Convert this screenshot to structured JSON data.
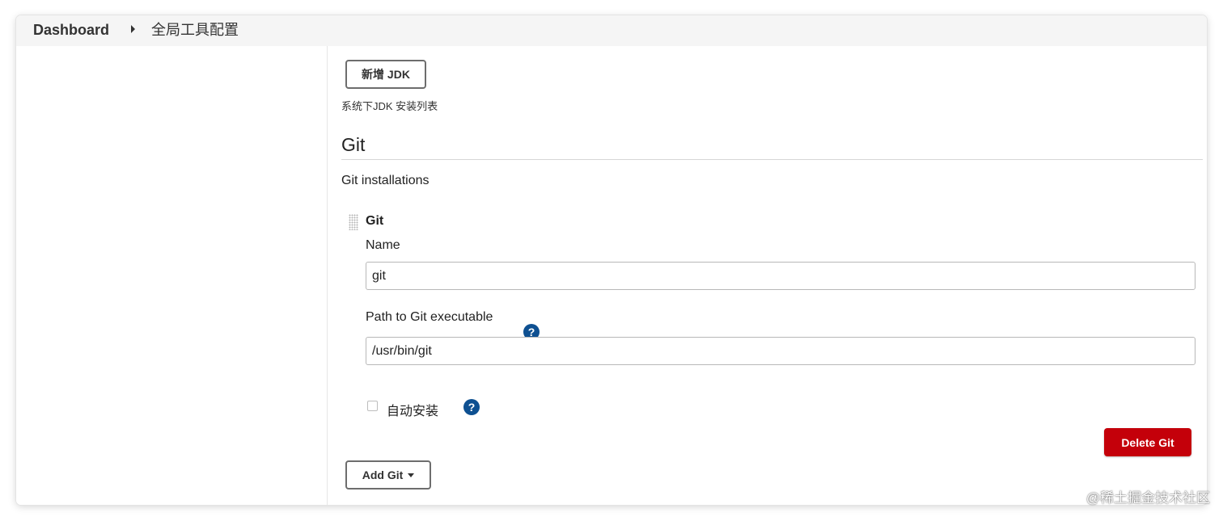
{
  "breadcrumb": {
    "home": "Dashboard",
    "current": "全局工具配置"
  },
  "jdk": {
    "add_button": "新增 JDK",
    "description": "系统下JDK 安装列表"
  },
  "git_section": {
    "title": "Git",
    "installations_label": "Git installations",
    "item": {
      "title": "Git",
      "name_label": "Name",
      "name_value": "git",
      "path_label": "Path to Git executable",
      "path_value": "/usr/bin/git",
      "auto_install_label": "自动安装",
      "auto_install_checked": false,
      "help_glyph": "?",
      "delete_button": "Delete Git"
    },
    "add_button": "Add Git"
  },
  "watermark": "@稀土掘金技术社区",
  "colors": {
    "delete_button": "#c4000a",
    "help_icon": "#0e5091",
    "breadcrumb_bar": "#f5f5f5"
  }
}
